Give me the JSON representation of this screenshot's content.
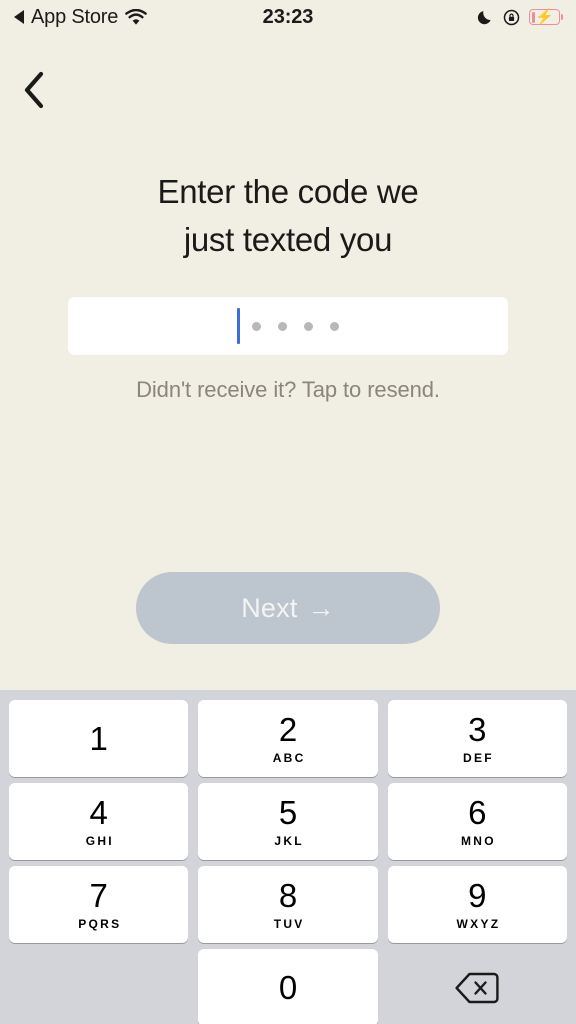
{
  "status_bar": {
    "back_app_label": "App Store",
    "back_indicator_icon": "triangle-left-icon",
    "wifi_icon": "wifi-icon",
    "time": "23:23",
    "do_not_disturb_icon": "moon-icon",
    "rotation_lock_icon": "rotation-lock-icon",
    "battery_icon": "battery-charging-low-icon",
    "battery_color": "#E8909A"
  },
  "nav": {
    "back_icon": "chevron-left-icon"
  },
  "screen": {
    "heading": "Enter the code we\njust texted you",
    "background_color": "#F1EEE4"
  },
  "code_input": {
    "value": "",
    "placeholder_dots": 4,
    "caret_color": "#3D6FDB",
    "dot_color": "#B8B8B8",
    "field_color": "#FFFFFF"
  },
  "resend": {
    "label": "Didn't receive it? Tap to resend.",
    "color": "#8A8679"
  },
  "next_button": {
    "label": "Next",
    "arrow": "→",
    "enabled": false,
    "color": "#BDC5CE",
    "text_color": "#F4F4F2"
  },
  "keyboard": {
    "background_color": "#D2D4D9",
    "key_color": "#FFFFFF",
    "rows": [
      [
        {
          "digit": "1",
          "letters": ""
        },
        {
          "digit": "2",
          "letters": "ABC"
        },
        {
          "digit": "3",
          "letters": "DEF"
        }
      ],
      [
        {
          "digit": "4",
          "letters": "GHI"
        },
        {
          "digit": "5",
          "letters": "JKL"
        },
        {
          "digit": "6",
          "letters": "MNO"
        }
      ],
      [
        {
          "digit": "7",
          "letters": "PQRS"
        },
        {
          "digit": "8",
          "letters": "TUV"
        },
        {
          "digit": "9",
          "letters": "WXYZ"
        }
      ]
    ],
    "last_row": {
      "zero": {
        "digit": "0",
        "letters": ""
      },
      "backspace_icon": "backspace-delete-icon"
    }
  }
}
